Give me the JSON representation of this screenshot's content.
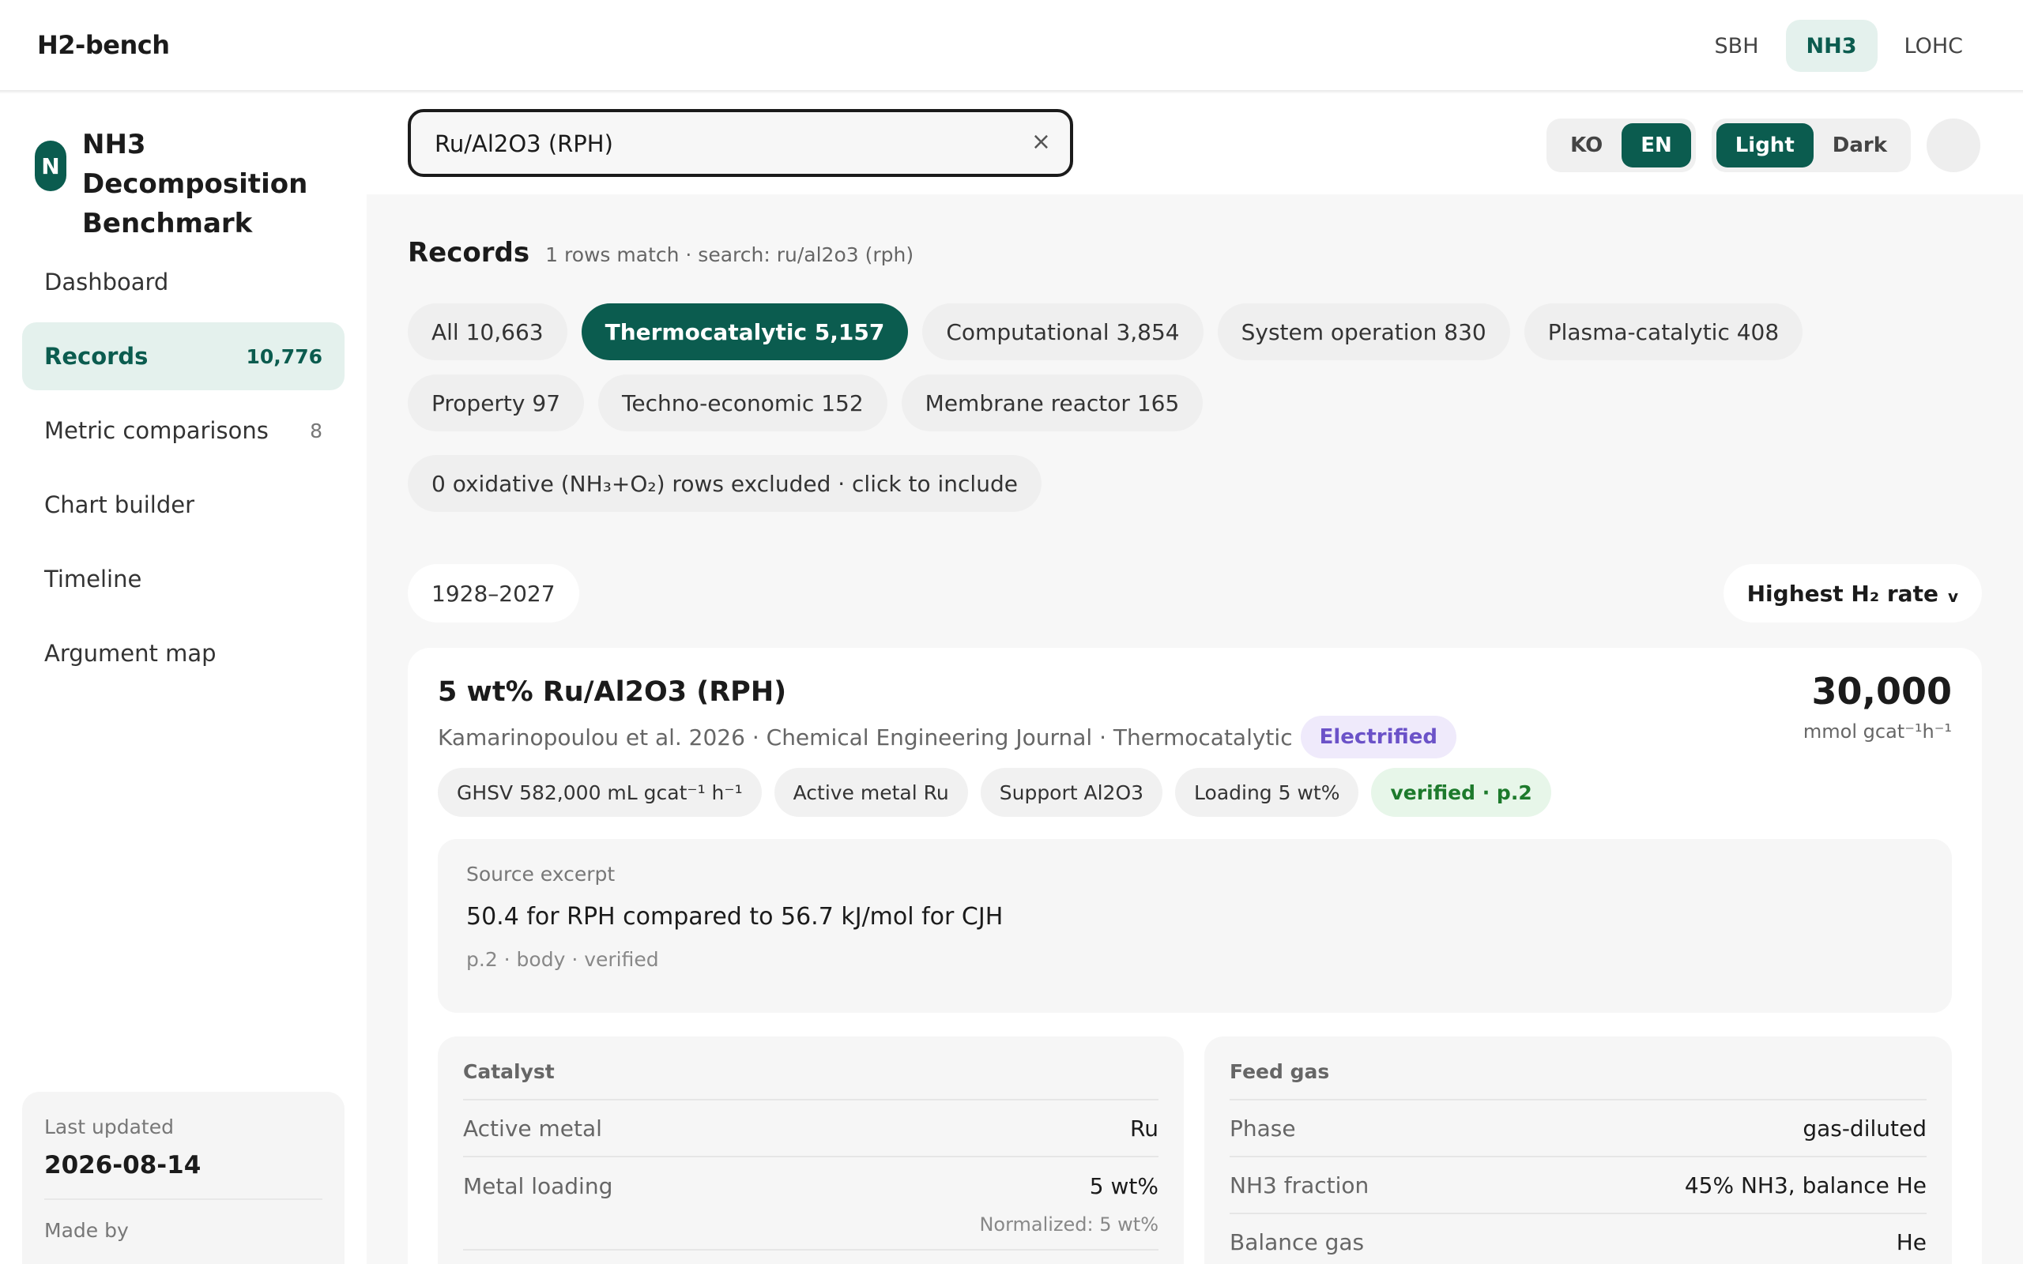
{
  "app": {
    "brand": "H2-bench"
  },
  "domain_tabs": [
    {
      "label": "SBH",
      "active": false
    },
    {
      "label": "NH3",
      "active": true
    },
    {
      "label": "LOHC",
      "active": false
    }
  ],
  "sidebar": {
    "logo_letter": "N",
    "title": "NH3 Decomposition Benchmark",
    "items": [
      {
        "label": "Dashboard",
        "count": ""
      },
      {
        "label": "Records",
        "count": "10,776"
      },
      {
        "label": "Metric comparisons",
        "count": "8"
      },
      {
        "label": "Chart builder",
        "count": ""
      },
      {
        "label": "Timeline",
        "count": ""
      },
      {
        "label": "Argument map",
        "count": ""
      }
    ],
    "footer": {
      "last_updated_label": "Last updated",
      "last_updated_value": "2026-08-14",
      "made_by_label": "Made by"
    }
  },
  "search": {
    "value": "Ru/Al2O3 (RPH)",
    "clear_glyph": "×"
  },
  "lang": {
    "ko": "KO",
    "en": "EN",
    "active": "EN"
  },
  "theme": {
    "light": "Light",
    "dark": "Dark",
    "active": "Light"
  },
  "records": {
    "title": "Records",
    "meta": "1 rows match · search: ru/al2o3 (rph)",
    "chips": [
      {
        "label": "All 10,663",
        "active": false
      },
      {
        "label": "Thermocatalytic 5,157",
        "active": true
      },
      {
        "label": "Computational 3,854",
        "active": false
      },
      {
        "label": "System operation 830",
        "active": false
      },
      {
        "label": "Plasma-catalytic 408",
        "active": false
      },
      {
        "label": "Property 97",
        "active": false
      },
      {
        "label": "Techno-economic 152",
        "active": false
      },
      {
        "label": "Membrane reactor 165",
        "active": false
      }
    ],
    "excluded": "0 oxidative (NH₃+O₂) rows excluded · click to include",
    "year_range": "1928–2027",
    "sort": {
      "label": "Highest H₂ rate",
      "chevron": "v"
    }
  },
  "card": {
    "title": "5 wt% Ru/Al2O3 (RPH)",
    "subtitle": "Kamarinopoulou et al. 2026 · Chemical Engineering Journal · Thermocatalytic",
    "badge": "Electrified",
    "value": "30,000",
    "unit": "mmol gcat⁻¹h⁻¹",
    "tags": [
      {
        "label": "GHSV 582,000 mL gcat⁻¹ h⁻¹",
        "verified": false
      },
      {
        "label": "Active metal Ru",
        "verified": false
      },
      {
        "label": "Support Al2O3",
        "verified": false
      },
      {
        "label": "Loading 5 wt%",
        "verified": false
      },
      {
        "label": "verified · p.2",
        "verified": true
      }
    ],
    "excerpt": {
      "label": "Source excerpt",
      "text": "50.4 for RPH compared to 56.7 kJ/mol for CJH",
      "meta": "p.2 · body · verified"
    },
    "catalyst": {
      "title": "Catalyst",
      "rows": [
        {
          "key": "Active metal",
          "value": "Ru"
        },
        {
          "key": "Metal loading",
          "value": "5 wt%",
          "note": "Normalized: 5 wt%"
        }
      ]
    },
    "feed_gas": {
      "title": "Feed gas",
      "rows": [
        {
          "key": "Phase",
          "value": "gas-diluted"
        },
        {
          "key": "NH3 fraction",
          "value": "45% NH3, balance He"
        },
        {
          "key": "Balance gas",
          "value": "He"
        }
      ]
    }
  }
}
